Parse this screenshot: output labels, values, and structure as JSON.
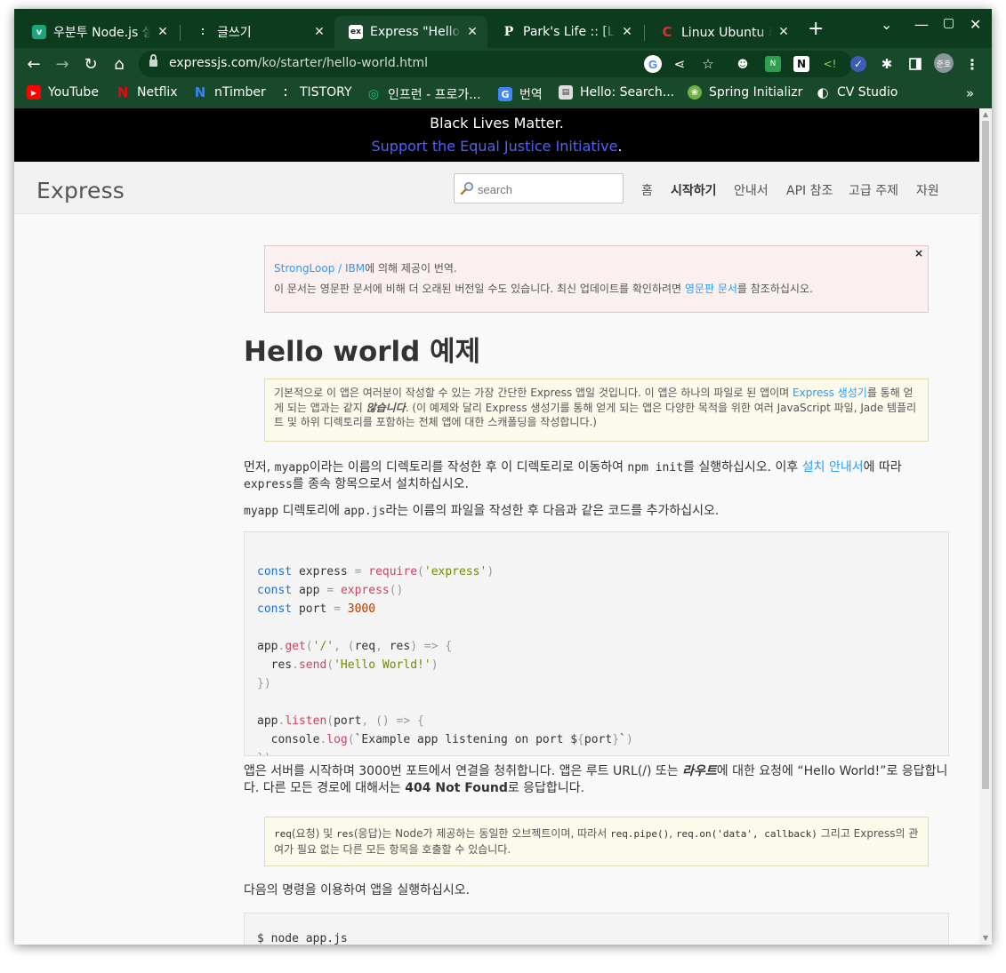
{
  "browser": {
    "tabs": [
      {
        "title": "우분투 Node.js 설치",
        "favicon": "v",
        "favicon_bg": "#1aa77b",
        "active": false
      },
      {
        "title": "글쓰기",
        "favicon": "⁚",
        "favicon_bg": "transparent",
        "active": false
      },
      {
        "title": "Express \"Hello World\"",
        "favicon": "ex",
        "favicon_bg": "#ffffff",
        "active": true
      },
      {
        "title": "Park's Life :: [Linux]",
        "favicon": "P",
        "favicon_bg": "transparent",
        "active": false
      },
      {
        "title": "Linux Ubuntu 화면",
        "favicon": "C",
        "favicon_bg": "transparent",
        "active": false
      }
    ],
    "url_host": "expressjs.com",
    "url_path": "/ko/starter/hello-world.html",
    "profile_initials": "준호",
    "bookmarks": [
      {
        "label": "YouTube",
        "icon": "▶",
        "color": "#ff0000"
      },
      {
        "label": "Netflix",
        "icon": "N",
        "color": "#e50914"
      },
      {
        "label": "nTimber",
        "icon": "N",
        "color": "#2c6fe0"
      },
      {
        "label": "TISTORY",
        "icon": "⁚",
        "color": "#ffffff"
      },
      {
        "label": "인프런 - 프로가...",
        "icon": "◎",
        "color": "#1dc078"
      },
      {
        "label": "번역",
        "icon": "G",
        "color": "#4285f4"
      },
      {
        "label": "Hello: Search...",
        "icon": "▤",
        "color": "#cccccc"
      },
      {
        "label": "Spring Initializr",
        "icon": "❀",
        "color": "#6db33f"
      },
      {
        "label": "CV Studio",
        "icon": "◐",
        "color": "#ffffff"
      }
    ]
  },
  "banner": {
    "line1": "Black Lives Matter.",
    "link": "Support the Equal Justice Initiative",
    "suffix": "."
  },
  "header": {
    "logo": "Express",
    "search_placeholder": "search",
    "nav": [
      "홈",
      "시작하기",
      "안내서",
      "API 참조",
      "고급 주제",
      "자원"
    ],
    "active_nav": "시작하기"
  },
  "notice": {
    "line1_link": "StrongLoop / IBM",
    "line1_rest": "에 의해 제공이 번역.",
    "line2_pre": "이 문서는 영문판 문서에 비해 더 오래된 버전일 수도 있습니다. 최신 업데이트를 확인하려면 ",
    "line2_link": "영문판 문서",
    "line2_post": "를 참조하십시오.",
    "close": "×"
  },
  "article": {
    "title": "Hello world 예제",
    "note1_a": "기본적으로 이 앱은 여러분이 작성할 수 있는 가장 간단한 Express 앱일 것입니다. 이 앱은 하나의 파일로 된 앱이며 ",
    "note1_link": "Express 생성기",
    "note1_b": "를 통해 얻게 되는 앱과는 같지 ",
    "note1_em": "않습니다",
    "note1_c": ". (이 예제와 달리 Express 생성기를 통해 얻게 되는 앱은 다양한 목적을 위한 여러 JavaScript 파일, Jade 템플리트 및 하위 디렉토리를 포함하는 전체 앱에 대한 스캐폴딩을 작성합니다.)",
    "p1_a": "먼저, ",
    "p1_code1": "myapp",
    "p1_b": "이라는 이름의 디렉토리를 작성한 후 이 디렉토리로 이동하여 ",
    "p1_code2": "npm init",
    "p1_c": "를 실행하십시오. 이후 ",
    "p1_link": "설치 안내서",
    "p1_d": "에 따라 ",
    "p1_code3": "express",
    "p1_e": "를 종속 항목으로서 설치하십시오.",
    "p2_code1": "myapp",
    "p2_a": " 디렉토리에 ",
    "p2_code2": "app.js",
    "p2_b": "라는 이름의 파일을 작성한 후 다음과 같은 코드를 추가하십시오.",
    "p3_a": "앱은 서버를 시작하며 3000번 포트에서 연결을 청취합니다. 앱은 루트 URL(",
    "p3_code": "/",
    "p3_b": ") 또는 ",
    "p3_em": "라우트",
    "p3_c": "에 대한 요청에 “Hello World!”로 응답합니다. 다른 모든 경로에 대해서는 ",
    "p3_strong": "404 Not Found",
    "p3_d": "로 응답합니다.",
    "note2_code1": "req",
    "note2_a": "(요청) 및 ",
    "note2_code2": "res",
    "note2_b": "(응답)는 Node가 제공하는 동일한 오브젝트이며, 따라서 ",
    "note2_code3": "req.pipe()",
    "note2_c": ", ",
    "note2_code4": "req.on('data', callback)",
    "note2_d": " 그리고 Express의 관여가 필요 없는 다른 모든 항목을 호출할 수 있습니다.",
    "p4": "다음의 명령을 이용하여 앱을 실행하십시오.",
    "cmd": "$ node app.js"
  },
  "code": {
    "const": "const",
    "express": "express",
    "require": "require",
    "express_str": "'express'",
    "app": "app",
    "port": "port",
    "n3000": "3000",
    "get": "get",
    "root_str": "'/'",
    "req": "req",
    "res": "res",
    "send": "send",
    "hello_str": "'Hello World!'",
    "listen": "listen",
    "console": "console",
    "log": "log",
    "tpl_a": "`Example app listening on port $",
    "tpl_b": "`"
  }
}
